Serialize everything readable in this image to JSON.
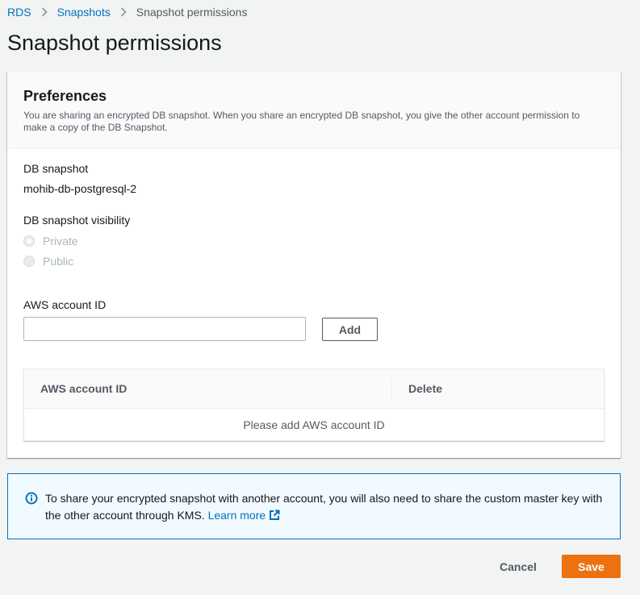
{
  "breadcrumb": {
    "items": [
      "RDS",
      "Snapshots"
    ],
    "current": "Snapshot permissions"
  },
  "page": {
    "title": "Snapshot permissions"
  },
  "preferences": {
    "title": "Preferences",
    "description": "You are sharing an encrypted DB snapshot. When you share an encrypted DB snapshot, you give the other account permission to make a copy of the DB Snapshot.",
    "db_snapshot_label": "DB snapshot",
    "db_snapshot_value": "mohib-db-postgresql-2",
    "visibility_label": "DB snapshot visibility",
    "visibility_options": [
      {
        "label": "Private",
        "selected": true,
        "disabled": true
      },
      {
        "label": "Public",
        "selected": false,
        "disabled": true
      }
    ],
    "account_id_label": "AWS account ID",
    "account_id_value": "",
    "account_id_placeholder": "",
    "add_label": "Add",
    "table": {
      "columns": [
        "AWS account ID",
        "Delete"
      ],
      "empty_text": "Please add AWS account ID"
    }
  },
  "info": {
    "icon": "info-icon",
    "text": "To share your encrypted snapshot with another account, you will also need to share the custom master key with the other account through KMS.",
    "link_label": "Learn more"
  },
  "actions": {
    "cancel_label": "Cancel",
    "save_label": "Save"
  },
  "colors": {
    "accent": "#ec7211",
    "link": "#0073bb",
    "info_bg": "#f1faff"
  }
}
